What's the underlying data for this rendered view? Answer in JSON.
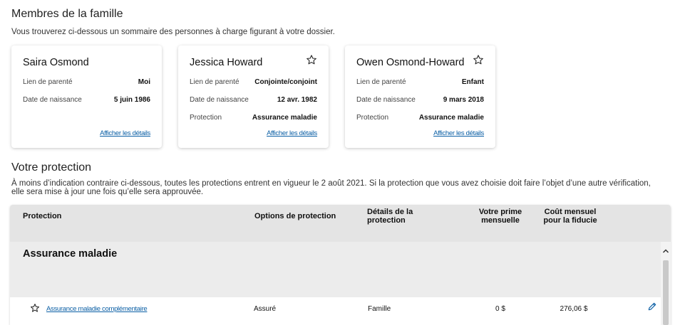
{
  "family": {
    "title": "Membres de la famille",
    "description": "Vous trouverez ci-dessous un sommaire des personnes à charge figurant à votre dossier.",
    "members": [
      {
        "name": "Saira Osmond",
        "starred": false,
        "rows": [
          {
            "label": "Lien de parenté",
            "value": "Moi"
          },
          {
            "label": "Date de naissance",
            "value": "5 juin 1986"
          }
        ],
        "details_link": "Afficher les détails"
      },
      {
        "name": "Jessica Howard",
        "starred": true,
        "rows": [
          {
            "label": "Lien de parenté",
            "value": "Conjointe/conjoint"
          },
          {
            "label": "Date de naissance",
            "value": "12 avr. 1982"
          },
          {
            "label": "Protection",
            "value": "Assurance maladie"
          }
        ],
        "details_link": "Afficher les détails"
      },
      {
        "name": "Owen Osmond-Howard",
        "starred": true,
        "rows": [
          {
            "label": "Lien de parenté",
            "value": "Enfant"
          },
          {
            "label": "Date de naissance",
            "value": "9 mars 2018"
          },
          {
            "label": "Protection",
            "value": "Assurance maladie"
          }
        ],
        "details_link": "Afficher les détails"
      }
    ]
  },
  "protection": {
    "title": "Votre protection",
    "description_line1": "À moins d’indication contraire ci-dessous, toutes les protections entrent en vigueur le 2 août 2021. Si la protection que vous avez choisie doit faire l’objet d’une autre vérification,",
    "description_line2": "elle sera mise à jour une fois qu’elle sera approuvée.",
    "headers": {
      "protection": "Protection",
      "options": "Options de protection",
      "details_l1": "Détails de la",
      "details_l2": "protection",
      "premium_l1": "Votre prime",
      "premium_l2": "mensuelle",
      "cost_l1": "Coût mensuel",
      "cost_l2": "pour la fiducie"
    },
    "group": "Assurance maladie",
    "rows": [
      {
        "name": "Assurance maladie complémentaire",
        "option": "Assuré",
        "details": "Famille",
        "premium": "0 $",
        "cost": "276,06 $"
      }
    ]
  },
  "icons": {
    "star": "star-outline-icon",
    "edit": "pencil-icon",
    "scroll_up": "chevron-up-icon"
  },
  "colors": {
    "link": "#0b5fa5",
    "header_bg": "#e4e4e4",
    "group_bg": "#ececec"
  }
}
